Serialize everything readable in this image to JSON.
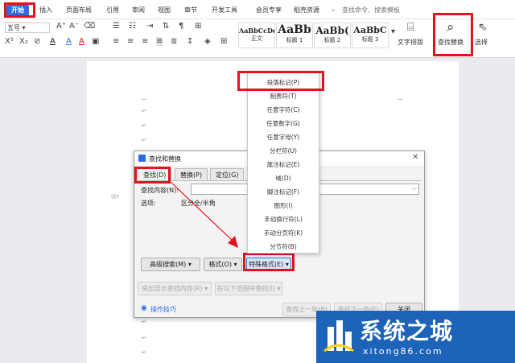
{
  "menubar": {
    "tabs": [
      "开始",
      "插入",
      "页面布局",
      "引用",
      "审阅",
      "视图",
      "章节",
      "开发工具",
      "会员专享",
      "稻壳资源"
    ],
    "search_placeholder": "查找命令、搜索模板"
  },
  "toolbar": {
    "font_size": "五号",
    "styles": [
      {
        "sample": "AaBbCcDd",
        "name": "正文"
      },
      {
        "sample": "AaBb",
        "name": "标题 1"
      },
      {
        "sample": "AaBb(",
        "name": "标题 2"
      },
      {
        "sample": "AaBbC",
        "name": "标题 3"
      }
    ],
    "text_layout": "文字排版",
    "find_replace": "查找替换",
    "select": "选择"
  },
  "dialog": {
    "title": "查找和替换",
    "tabs": [
      "查找(D)",
      "替换(P)",
      "定位(G)"
    ],
    "find_label": "查找内容(N):",
    "find_value": "",
    "options_label": "选项:",
    "options_value": "区分全/半角",
    "buttons": {
      "advanced": "高级搜索(M)",
      "format": "格式(O)",
      "special": "特殊格式(E)",
      "highlight": "突出显示查找内容(R)",
      "find_in": "在以下范围中查找(I)",
      "find_prev": "查找上一处(B)",
      "find_next": "查找下一处(F)",
      "close": "关闭"
    },
    "tips": "操作技巧"
  },
  "special_menu": [
    "段落标记(P)",
    "制表符(T)",
    "任意字符(C)",
    "任意数字(G)",
    "任意字母(Y)",
    "分栏符(U)",
    "尾注标记(E)",
    "域(D)",
    "脚注标记(F)",
    "图形(I)",
    "手动换行符(L)",
    "手动分页符(K)",
    "分节符(B)"
  ],
  "watermark": {
    "brand": "系统之城",
    "site": "xitong86.com"
  },
  "colors": {
    "accent": "#2b6de0",
    "highlight": "#e0141e",
    "watermark_bg": "#1d63b8"
  }
}
